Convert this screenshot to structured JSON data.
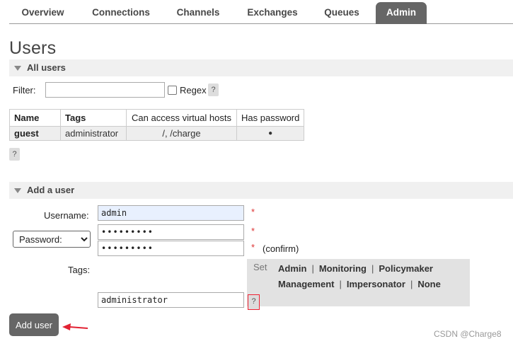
{
  "nav": {
    "tabs": [
      {
        "label": "Overview"
      },
      {
        "label": "Connections"
      },
      {
        "label": "Channels"
      },
      {
        "label": "Exchanges"
      },
      {
        "label": "Queues"
      },
      {
        "label": "Admin",
        "active": true
      }
    ]
  },
  "page_title": "Users",
  "all_users": {
    "section_label": "All users",
    "filter_label": "Filter:",
    "filter_value": "",
    "regex_label": "Regex",
    "help": "?",
    "table": {
      "columns": [
        "Name",
        "Tags",
        "Can access virtual hosts",
        "Has password"
      ],
      "rows": [
        {
          "name": "guest",
          "tags": "administrator",
          "vhosts": "/, /charge",
          "has_password": "●"
        }
      ]
    },
    "table_help": "?"
  },
  "add_user": {
    "section_label": "Add a user",
    "username_label": "Username:",
    "username_value": "admin",
    "password_mode": "Password:",
    "password_value": "•••••••••",
    "confirm_value": "•••••••••",
    "required_mark": "*",
    "confirm_label": "(confirm)",
    "tags_label": "Tags:",
    "set_label": "Set",
    "tag_options": [
      "Admin",
      "Monitoring",
      "Policymaker",
      "Management",
      "Impersonator",
      "None"
    ],
    "separator": "|",
    "tags_value": "administrator",
    "tags_help": "?",
    "submit_label": "Add user"
  },
  "watermark": "CSDN @Charge8",
  "colors": {
    "active_tab": "#666666",
    "button": "#666666",
    "required": "#dd3333",
    "annotation": "#e22233"
  }
}
